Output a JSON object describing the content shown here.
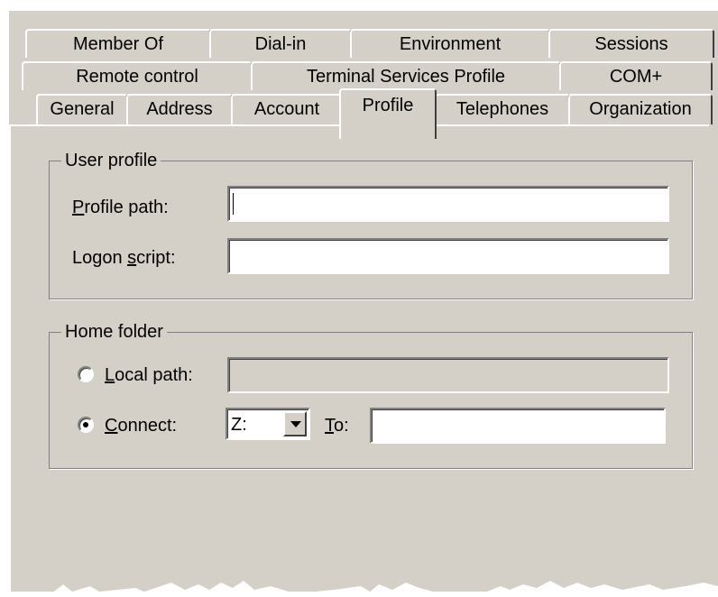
{
  "tabs": {
    "row1": [
      "Member Of",
      "Dial-in",
      "Environment",
      "Sessions"
    ],
    "row2": [
      "Remote control",
      "Terminal Services Profile",
      "COM+"
    ],
    "row3": [
      "General",
      "Address",
      "Account",
      "Profile",
      "Telephones",
      "Organization"
    ],
    "active": "Profile"
  },
  "user_profile": {
    "legend": "User profile",
    "profile_path_label": {
      "mnemonic": "P",
      "rest": "rofile path:"
    },
    "profile_path_value": "",
    "logon_script_label": {
      "pre": "Logon ",
      "mnemonic": "s",
      "rest": "cript:"
    },
    "logon_script_value": ""
  },
  "home_folder": {
    "legend": "Home folder",
    "local_path": {
      "mnemonic": "L",
      "rest": "ocal path:",
      "selected": false,
      "value": "",
      "enabled": false
    },
    "connect": {
      "mnemonic": "C",
      "rest": "onnect:",
      "selected": true
    },
    "drive_value": "Z:",
    "to_label": {
      "mnemonic": "T",
      "rest": "o:"
    },
    "to_value": ""
  }
}
